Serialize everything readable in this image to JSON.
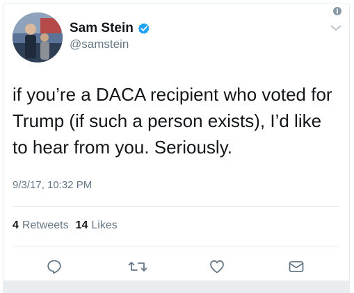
{
  "tweet": {
    "author": {
      "display_name": "Sam Stein",
      "handle": "@samstein",
      "verified": true
    },
    "text": "if you’re a DACA recipient who voted for Trump (if such a person exists), I’d like to hear from you. Seriously.",
    "timestamp": "9/3/17, 10:32 PM",
    "stats": {
      "retweets_count": "4",
      "retweets_label": "Retweets",
      "likes_count": "14",
      "likes_label": "Likes"
    }
  },
  "icons": {
    "info": "info-icon",
    "menu": "chevron-down-icon",
    "verified": "verified-badge-icon",
    "reply": "reply-icon",
    "retweet": "retweet-icon",
    "like": "heart-icon",
    "message": "envelope-icon"
  },
  "colors": {
    "verified_blue": "#1da1f2",
    "secondary_text": "#657786",
    "primary_text": "#14171a",
    "border": "#e6ecf0"
  }
}
